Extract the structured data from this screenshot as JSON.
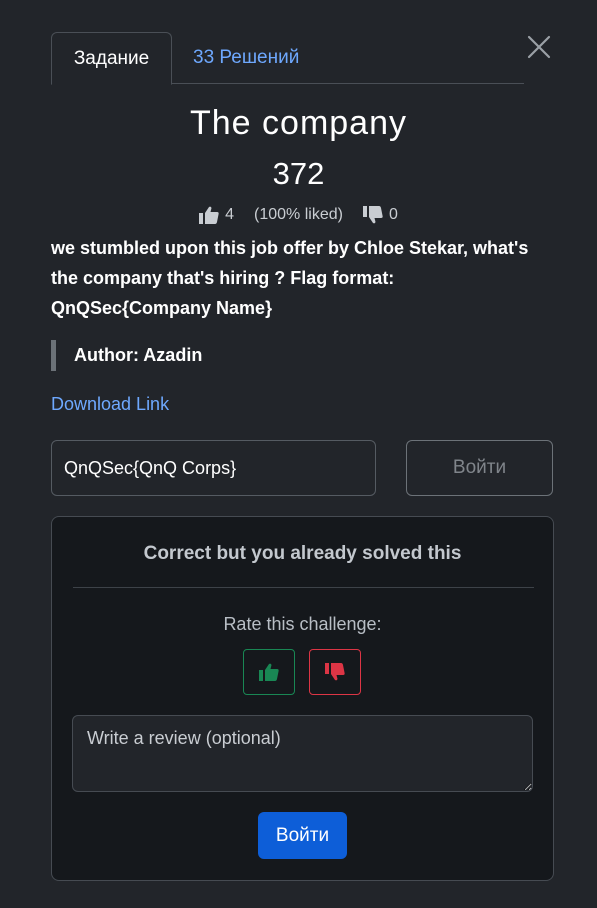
{
  "tabs": {
    "challenge_label": "Задание",
    "solves_label": "33 Решений"
  },
  "challenge": {
    "title": "The company",
    "points": "372",
    "likes": "4",
    "liked_percent": "(100% liked)",
    "dislikes": "0",
    "description": "we stumbled upon this job offer by Chloe Stekar, what's the company that's hiring ? Flag format: QnQSec{Company Name}",
    "author": "Author: Azadin",
    "download_label": "Download Link"
  },
  "submission": {
    "flag_value": "QnQSec{QnQ Corps}",
    "submit_label": "Войти"
  },
  "result": {
    "message": "Correct but you already solved this",
    "rate_label": "Rate this challenge:",
    "review_placeholder": "Write a review (optional)",
    "submit_label": "Войти"
  },
  "colors": {
    "background": "#22252a",
    "accent_link": "#6ea8fe",
    "success": "#198754",
    "danger": "#dc3545",
    "primary_button": "#0d5ed8"
  },
  "icons": [
    "close-icon",
    "thumbs-up-icon",
    "thumbs-down-icon"
  ]
}
